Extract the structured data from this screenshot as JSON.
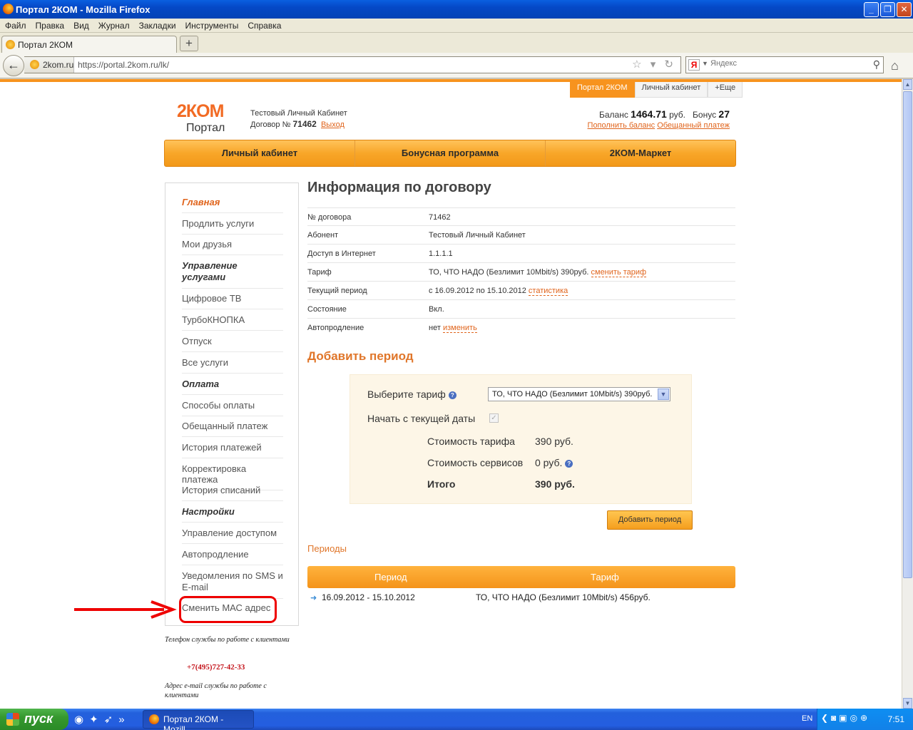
{
  "window": {
    "title": "Портал 2КОМ - Mozilla Firefox"
  },
  "menu": [
    "Файл",
    "Правка",
    "Вид",
    "Журнал",
    "Закладки",
    "Инструменты",
    "Справка"
  ],
  "browser": {
    "tab_title": "Портал 2КОМ",
    "new_tab": "+",
    "site_identity": "2kom.ru",
    "url": "https://portal.2kom.ru/lk/",
    "search_placeholder": "Яндекс",
    "search_engine_letter": "Я"
  },
  "portal": {
    "top_tabs": [
      "Портал 2КОМ",
      "Личный кабинет",
      "+Еще"
    ],
    "logo": "2КОМ",
    "logo_sub": "Портал",
    "account_name": "Тестовый Личный Кабинет",
    "contract_prefix": "Договор №",
    "contract_number": "71462",
    "logout": "Выход",
    "balance_label": "Баланс",
    "balance_value": "1464.71",
    "balance_unit": "руб.",
    "bonus_label": "Бонус",
    "bonus_value": "27",
    "topup_link": "Пополнить баланс",
    "promised_link": "Обещанный платеж",
    "main_nav": [
      "Личный кабинет",
      "Бонусная программа",
      "2КОМ-Маркет"
    ]
  },
  "sidebar": {
    "items": [
      {
        "label": "Главная",
        "type": "active"
      },
      {
        "label": "Продлить услуги",
        "type": "link"
      },
      {
        "label": "Мои друзья",
        "type": "link"
      },
      {
        "label": "Управление услугами",
        "type": "head"
      },
      {
        "label": "Цифровое ТВ",
        "type": "link"
      },
      {
        "label": "ТурбоКНОПКА",
        "type": "link"
      },
      {
        "label": "Отпуск",
        "type": "link"
      },
      {
        "label": "Все услуги",
        "type": "link"
      },
      {
        "label": "Оплата",
        "type": "head"
      },
      {
        "label": "Способы оплаты",
        "type": "link"
      },
      {
        "label": "Обещанный платеж",
        "type": "link"
      },
      {
        "label": "История платежей",
        "type": "link"
      },
      {
        "label": "Корректировка платежа",
        "type": "link"
      },
      {
        "label": "История списаний",
        "type": "link"
      },
      {
        "label": "Настройки",
        "type": "head"
      },
      {
        "label": "Управление доступом",
        "type": "link"
      },
      {
        "label": "Автопродление",
        "type": "link"
      },
      {
        "label": "Уведомления по SMS и E-mail",
        "type": "link"
      },
      {
        "label": "Сменить МАС адрес",
        "type": "link"
      }
    ]
  },
  "support": {
    "phone_label": "Телефон службы по работе с клиентами",
    "phone": "+7(495)727-42-33",
    "email_label": "Адрес e-mail службы по работе с клиентами"
  },
  "contract_info": {
    "title": "Информация по договору",
    "rows": [
      {
        "key": "№ договора",
        "value": "71462",
        "link": ""
      },
      {
        "key": "Абонент",
        "value": "Тестовый Личный Кабинет",
        "link": ""
      },
      {
        "key": "Доступ в Интернет",
        "value": "1.1.1.1",
        "link": ""
      },
      {
        "key": "Тариф",
        "value": "ТО, ЧТО НАДО (Безлимит 10Mbit/s) 390руб.",
        "link": "сменить тариф"
      },
      {
        "key": "Текущий период",
        "value": "с 16.09.2012 по 15.10.2012",
        "link": "статистика"
      },
      {
        "key": "Состояние",
        "value": "Вкл.",
        "link": ""
      },
      {
        "key": "Автопродление",
        "value": "нет",
        "link": "изменить"
      }
    ]
  },
  "add_period": {
    "title": "Добавить период",
    "tariff_label": "Выберите тариф",
    "tariff_selected": "ТО, ЧТО НАДО (Безлимит 10Mbit/s) 390руб.",
    "start_label": "Начать с текущей даты",
    "start_checked": true,
    "cost_label": "Стоимость тарифа",
    "cost_value": "390 руб.",
    "services_label": "Стоимость сервисов",
    "services_value": "0 руб.",
    "total_label": "Итого",
    "total_value": "390 руб.",
    "button": "Добавить период"
  },
  "periods": {
    "title": "Периоды",
    "col_period": "Период",
    "col_tariff": "Тариф",
    "rows": [
      {
        "period": "16.09.2012 - 15.10.2012",
        "tariff": "ТО, ЧТО НАДО (Безлимит 10Mbit/s) 456руб."
      }
    ]
  },
  "taskbar": {
    "start": "пуск",
    "task": "Портал 2КОМ - Mozill...",
    "lang": "EN",
    "clock": "7:51"
  },
  "colors": {
    "accent": "#f7931e",
    "link": "#e0641c",
    "annotation": "#e00000"
  }
}
